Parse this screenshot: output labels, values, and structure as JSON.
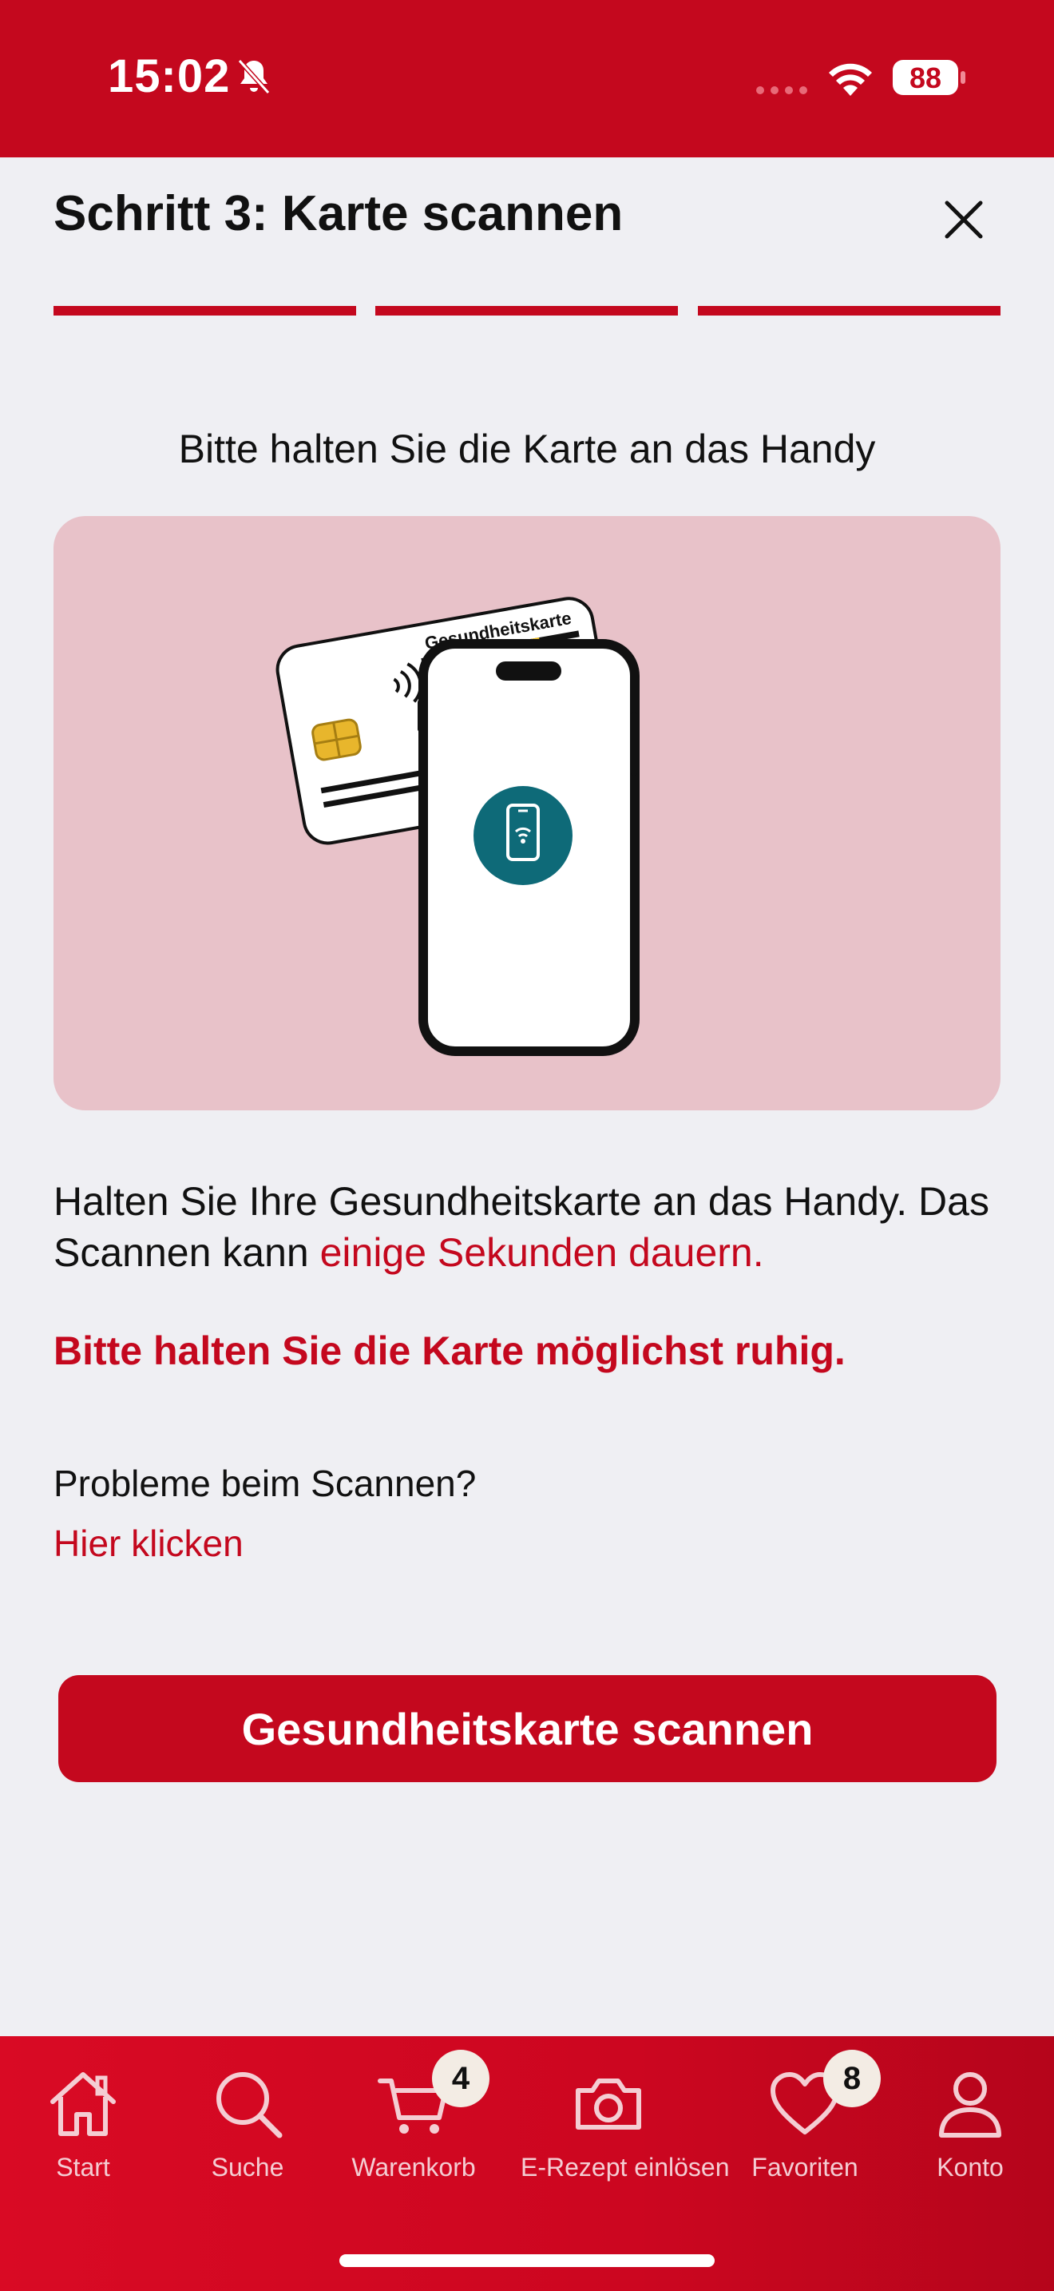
{
  "status_bar": {
    "time": "15:02",
    "battery": "88",
    "icons": [
      "bell-slash-icon",
      "signal-dots-icon",
      "wifi-icon",
      "battery-icon"
    ]
  },
  "header": {
    "title": "Schritt 3: Karte scannen",
    "close_icon": "close-icon",
    "steps_completed": 3,
    "steps_total": 3
  },
  "main": {
    "instruction": "Bitte halten Sie die Karte an das Handy",
    "illustration": {
      "card_label": "Gesundheitskarte",
      "icons": [
        "card-chip-icon",
        "contactless-icon",
        "phone-nfc-icon"
      ]
    },
    "paragraph": {
      "part1": "Halten Sie Ihre Gesundheitskarte an das Handy. Das Scannen kann ",
      "highlight": "einige Sekunden dauern."
    },
    "warning": "Bitte halten Sie die Karte möglichst ruhig.",
    "problem_text": "Probleme beim Scannen?",
    "problem_link": "Hier klicken",
    "scan_button": "Gesundheitskarte scannen"
  },
  "tabbar": {
    "items": [
      {
        "label": "Start",
        "icon": "home-icon"
      },
      {
        "label": "Suche",
        "icon": "search-icon"
      },
      {
        "label": "Warenkorb",
        "icon": "cart-icon",
        "badge": "4"
      },
      {
        "label": "E-Rezept einlösen",
        "icon": "camera-icon"
      },
      {
        "label": "Favoriten",
        "icon": "heart-icon",
        "badge": "8"
      },
      {
        "label": "Konto",
        "icon": "user-icon"
      }
    ]
  },
  "colors": {
    "brand_red": "#c4081e",
    "background": "#efeff3",
    "illustration_bg": "#e8c2c9",
    "badge_bg": "#f3ece4"
  }
}
